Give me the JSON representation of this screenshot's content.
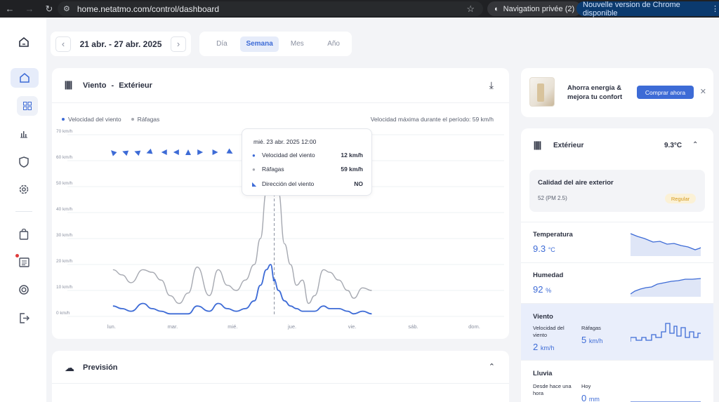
{
  "browser": {
    "url": "home.netatmo.com/control/dashboard",
    "incognito_label": "Navigation privée (2)",
    "update_label": "Nouvelle version de Chrome disponible"
  },
  "date_bar": {
    "range": "21 abr. - 27 abr. 2025",
    "periods": [
      "Día",
      "Semana",
      "Mes",
      "Año"
    ],
    "selected": "Semana"
  },
  "chart_card": {
    "title": "Viento",
    "separator": "-",
    "location": "Extérieur",
    "legend": [
      {
        "label": "Velocidad del viento",
        "color": "#3d6bd6"
      },
      {
        "label": "Ráfagas",
        "color": "#a6a9b1"
      }
    ],
    "max_text": "Velocidad máxima durante el período: 59 km/h",
    "tooltip": {
      "date": "mié. 23 abr. 2025 12:00",
      "rows": [
        {
          "label": "Velocidad del viento",
          "value": "12 km/h"
        },
        {
          "label": "Ráfagas",
          "value": "59 km/h"
        },
        {
          "label": "Dirección del viento",
          "value": "NO"
        }
      ]
    }
  },
  "chart_data": {
    "type": "line",
    "xlabel": "",
    "ylabel": "",
    "ylim": [
      0,
      70
    ],
    "y_ticks": [
      "0 km/h",
      "10 km/h",
      "20 km/h",
      "30 km/h",
      "40 km/h",
      "50 km/h",
      "60 km/h",
      "70 km/h"
    ],
    "x_ticks": [
      "lun.",
      "mar.",
      "mié.",
      "jue.",
      "vie.",
      "sáb.",
      "dom."
    ],
    "x_range_days": [
      0,
      6
    ],
    "grid": true,
    "series": [
      {
        "name": "Ráfagas",
        "color": "#a6a9b1",
        "x": [
          0.0,
          0.15,
          0.3,
          0.5,
          0.65,
          0.8,
          0.95,
          1.1,
          1.25,
          1.4,
          1.6,
          1.75,
          1.9,
          2.05,
          2.2,
          2.35,
          2.45,
          2.55,
          2.62,
          2.68,
          2.75,
          2.85,
          2.95,
          3.05,
          3.15,
          3.25,
          3.35,
          3.5,
          3.6,
          3.75,
          3.9,
          4.0,
          4.15,
          4.3
        ],
        "values": [
          18,
          16,
          13,
          18,
          17,
          14,
          8,
          5,
          9,
          19,
          8,
          18,
          12,
          10,
          14,
          20,
          30,
          48,
          55,
          59,
          48,
          28,
          20,
          12,
          14,
          5,
          8,
          18,
          17,
          14,
          10,
          7,
          11,
          10
        ]
      },
      {
        "name": "Velocidad del viento",
        "color": "#3d6bd6",
        "x": [
          0.0,
          0.15,
          0.3,
          0.5,
          0.65,
          0.8,
          0.95,
          1.1,
          1.25,
          1.4,
          1.6,
          1.75,
          1.9,
          2.05,
          2.2,
          2.35,
          2.45,
          2.55,
          2.62,
          2.68,
          2.75,
          2.85,
          2.95,
          3.05,
          3.15,
          3.25,
          3.35,
          3.5,
          3.6,
          3.75,
          3.9,
          4.0,
          4.15,
          4.3
        ],
        "values": [
          4,
          3,
          2,
          5,
          3,
          2,
          1,
          1,
          1,
          4,
          2,
          5,
          3,
          2,
          3,
          6,
          12,
          18,
          20,
          14,
          10,
          6,
          4,
          3,
          2,
          2,
          2,
          4,
          3,
          3,
          2,
          1,
          2,
          1
        ]
      }
    ],
    "direction_arrows": {
      "x": [
        0.0,
        0.2,
        0.4,
        0.6,
        0.85,
        1.05,
        1.25,
        1.45,
        1.7,
        1.95,
        2.2,
        2.45,
        2.68
      ],
      "rotations_deg": [
        225,
        200,
        200,
        160,
        180,
        180,
        270,
        0,
        0,
        30,
        240,
        10,
        315
      ]
    },
    "highlight_x": 2.68
  },
  "forecast": {
    "title": "Previsión"
  },
  "promo": {
    "text": "Ahorra energía & mejora tu confort",
    "button": "Comprar ahora"
  },
  "station": {
    "name": "Extérieur",
    "temp": "9.3°C",
    "air_quality": {
      "title": "Calidad del aire exterior",
      "value": "52 (PM 2.5)",
      "badge": "Regular"
    },
    "temperature": {
      "title": "Temperatura",
      "value": "9.3",
      "unit": "°C"
    },
    "humidity": {
      "title": "Humedad",
      "value": "92",
      "unit": "%"
    },
    "wind": {
      "title": "Viento",
      "speed_label": "Velocidad del viento",
      "speed_value": "2",
      "speed_unit": "km/h",
      "gust_label": "Ráfagas",
      "gust_value": "5",
      "gust_unit": "km/h"
    },
    "rain": {
      "title": "Lluvia",
      "last_hour_label": "Desde hace una hora",
      "today_label": "Hoy",
      "today_value": "0",
      "today_unit": "mm"
    }
  }
}
